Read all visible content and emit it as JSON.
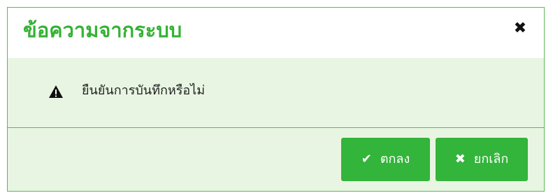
{
  "dialog": {
    "title": "ข้อความจากระบบ",
    "close_icon": "✖",
    "close_icon_name": "close-icon",
    "message_icon_name": "warning-triangle-icon",
    "message": "ยืนยันการบันทึกหรือไม่",
    "buttons": {
      "ok": {
        "label": "ตกลง",
        "icon": "✔",
        "icon_name": "check-icon"
      },
      "cancel": {
        "label": "ยกเลิก",
        "icon": "✖",
        "icon_name": "close-icon"
      }
    }
  },
  "colors": {
    "accent": "#36b236",
    "button_bg": "#33b43a",
    "body_bg": "#e8f5e2",
    "border": "#5cb85c"
  }
}
